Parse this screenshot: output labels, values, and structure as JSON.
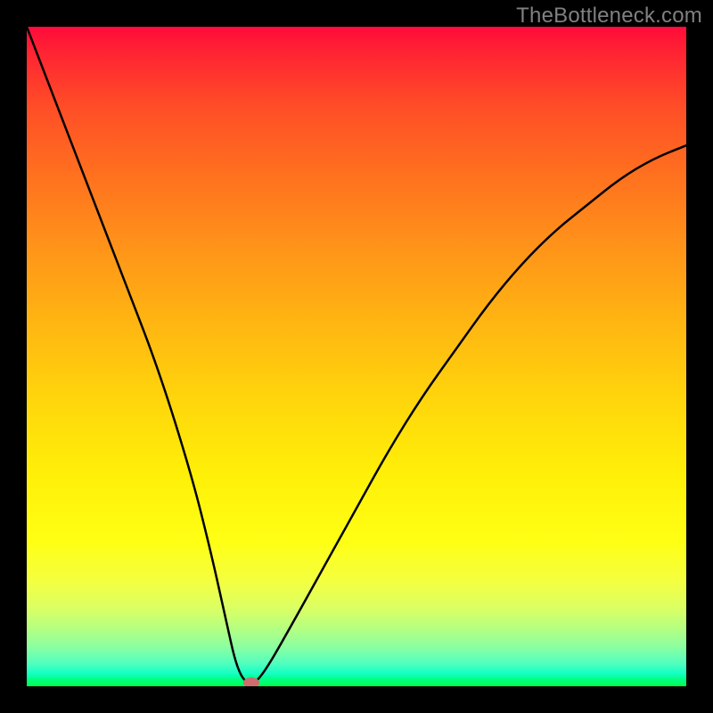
{
  "watermark": "TheBottleneck.com",
  "chart_data": {
    "type": "line",
    "title": "",
    "xlabel": "",
    "ylabel": "",
    "xlim": [
      0,
      100
    ],
    "ylim": [
      0,
      100
    ],
    "series": [
      {
        "name": "bottleneck-curve",
        "x": [
          0,
          5,
          10,
          15,
          20,
          25,
          28,
          30,
          32,
          34,
          36,
          40,
          45,
          50,
          55,
          60,
          65,
          70,
          75,
          80,
          85,
          90,
          95,
          100
        ],
        "values": [
          100,
          87,
          74,
          61,
          48,
          32,
          20,
          11,
          2,
          0,
          2,
          9,
          18,
          27,
          36,
          44,
          51,
          58,
          64,
          69,
          73,
          77,
          80,
          82
        ]
      }
    ],
    "minimum_point": {
      "x": 34,
      "y": 0
    },
    "gradient": {
      "top_color": "#ff0b3a",
      "bottom_color": "#00ff49"
    },
    "frame_color": "#000000",
    "curve_color": "#000000",
    "marker_color": "#cd6d6d"
  }
}
